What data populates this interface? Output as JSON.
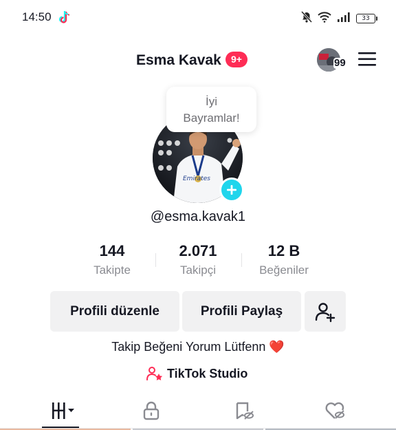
{
  "status_bar": {
    "time": "14:50",
    "battery": "33",
    "icons": [
      "tiktok-app-icon",
      "bell-muted-icon",
      "wifi-icon",
      "signal-icon",
      "battery-icon"
    ]
  },
  "header": {
    "title": "Esma Kavak",
    "notification_badge": "9+",
    "friends_count": "99",
    "menu_icon": "hamburger-menu-icon"
  },
  "profile": {
    "bubble_line1": "İyi",
    "bubble_line2": "Bayramlar!",
    "username": "@esma.kavak1",
    "add_icon": "plus-icon"
  },
  "stats": [
    {
      "value": "144",
      "label": "Takipte"
    },
    {
      "value": "2.071",
      "label": "Takipçi"
    },
    {
      "value": "12 B",
      "label": "Beğeniler"
    }
  ],
  "actions": {
    "edit_profile": "Profili düzenle",
    "share_profile": "Profili Paylaş",
    "add_friend_icon": "add-user-icon"
  },
  "bio": "Takip Beğeni Yorum Lütfenn ❤️",
  "studio": {
    "label": "TikTok Studio",
    "icon": "creator-star-icon"
  },
  "tabs": [
    {
      "icon": "videos-grid-icon",
      "selected": true
    },
    {
      "icon": "lock-icon",
      "selected": false
    },
    {
      "icon": "bookmark-hidden-icon",
      "selected": false
    },
    {
      "icon": "liked-hidden-icon",
      "selected": false
    }
  ],
  "colors": {
    "accent_red": "#fe2c55",
    "accent_cyan": "#20d5ec",
    "text": "#161823",
    "muted": "#8a8b91",
    "button_bg": "#f1f1f2"
  }
}
